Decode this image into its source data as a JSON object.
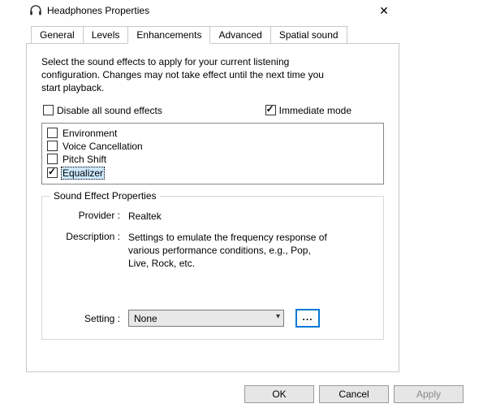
{
  "window": {
    "title": "Headphones Properties"
  },
  "tabs": {
    "items": [
      {
        "label": "General"
      },
      {
        "label": "Levels"
      },
      {
        "label": "Enhancements"
      },
      {
        "label": "Advanced"
      },
      {
        "label": "Spatial sound"
      }
    ],
    "active_index": 2
  },
  "intro": "Select the sound effects to apply for your current listening configuration. Changes may not take effect until the next time you start playback.",
  "options": {
    "disable_label": "Disable all sound effects",
    "disable_checked": false,
    "immediate_label": "Immediate mode",
    "immediate_checked": true
  },
  "effects": [
    {
      "label": "Environment",
      "checked": false,
      "selected": false
    },
    {
      "label": "Voice Cancellation",
      "checked": false,
      "selected": false
    },
    {
      "label": "Pitch Shift",
      "checked": false,
      "selected": false
    },
    {
      "label": "Equalizer",
      "checked": true,
      "selected": true
    }
  ],
  "properties": {
    "legend": "Sound Effect Properties",
    "provider_label": "Provider :",
    "provider_value": "Realtek",
    "description_label": "Description :",
    "description_value": "Settings to emulate the frequency response of various performance conditions,  e.g., Pop, Live, Rock, etc.",
    "setting_label": "Setting :",
    "setting_value": "None",
    "more_label": "..."
  },
  "footer": {
    "ok": "OK",
    "cancel": "Cancel",
    "apply": "Apply"
  }
}
